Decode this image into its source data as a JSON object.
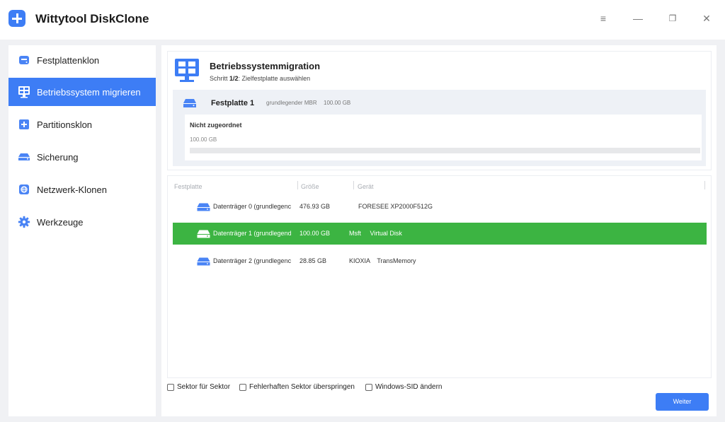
{
  "app": {
    "title": "Wittytool DiskClone"
  },
  "window_controls": {
    "menu": "≡",
    "minimize": "—",
    "restore": "❐",
    "close": "✕"
  },
  "sidebar": {
    "items": [
      {
        "label": "Festplattenklon",
        "icon": "disk-clone-icon"
      },
      {
        "label": "Betriebssystem migrieren",
        "icon": "os-migrate-icon"
      },
      {
        "label": "Partitionsklon",
        "icon": "partition-clone-icon"
      },
      {
        "label": "Sicherung",
        "icon": "backup-icon"
      },
      {
        "label": "Netzwerk-Klonen",
        "icon": "network-clone-icon"
      },
      {
        "label": "Werkzeuge",
        "icon": "gear-icon"
      }
    ],
    "active_index": 1
  },
  "header": {
    "title": "Betriebssystemmigration",
    "step_prefix": "Schritt ",
    "step_value": "1/2",
    "step_suffix": ": Zielfestplatte auswählen"
  },
  "selected_disk": {
    "name": "Festplatte 1",
    "type": "grundlegender MBR",
    "size": "100.00 GB",
    "partition": {
      "label": "Nicht zugeordnet",
      "size": "100.00 GB"
    }
  },
  "disk_table": {
    "columns": [
      "Festplatte",
      "Größe",
      "Gerät"
    ],
    "rows": [
      {
        "name": "Datenträger 0 (grundlegenc",
        "size": "476.93 GB",
        "device": "FORESEE XP2000F512G"
      },
      {
        "name": "Datenträger 1 (grundlegend",
        "size": "100.00 GB",
        "device": "Msft     Virtual Disk"
      },
      {
        "name": "Datenträger 2 (grundlegenc",
        "size": "28.85 GB",
        "device": "KIOXIA    TransMemory"
      }
    ],
    "selected_index": 1
  },
  "options": {
    "sector": "Sektor für Sektor",
    "skip_bad": "Fehlerhaften Sektor überspringen",
    "change_sid": "Windows-SID ändern"
  },
  "next_button": "Weiter",
  "colors": {
    "accent": "#3d7df5",
    "selected_row": "#3cb442"
  }
}
